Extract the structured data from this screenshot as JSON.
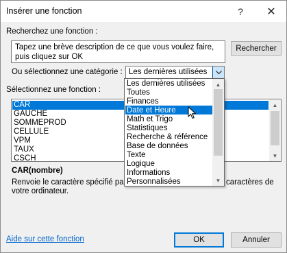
{
  "window": {
    "title": "Insérer une fonction",
    "help_glyph": "?",
    "close_glyph": "✕"
  },
  "search": {
    "label": "Recherchez une fonction :",
    "text_line1": "Tapez une brève description de ce que vous voulez faire,",
    "text_line2": "puis cliquez sur OK",
    "button_label": "Rechercher"
  },
  "category": {
    "label": "Ou sélectionnez une catégorie :",
    "selected": "Les dernières utilisées",
    "options": [
      "Les dernières utilisées",
      "Toutes",
      "Finances",
      "Date et Heure",
      "Math et Trigo",
      "Statistiques",
      "Recherche & référence",
      "Base de données",
      "Texte",
      "Logique",
      "Informations",
      "Personnalisées"
    ],
    "highlighted": "Date et Heure"
  },
  "functions": {
    "label": "Sélectionnez une fonction :",
    "items": [
      "CAR",
      "GAUCHE",
      "SOMMEPROD",
      "CELLULE",
      "VPM",
      "TAUX",
      "CSCH"
    ],
    "selected": "CAR"
  },
  "description": {
    "signature": "CAR(nombre)",
    "text_left": "Renvoie le caractère spécifié par",
    "text_right": "caractères de",
    "text_line2": "votre ordinateur."
  },
  "footer": {
    "help_link": "Aide sur cette fonction",
    "ok_label": "OK",
    "cancel_label": "Annuler"
  },
  "colors": {
    "accent": "#0078d7",
    "link": "#0066cc"
  }
}
